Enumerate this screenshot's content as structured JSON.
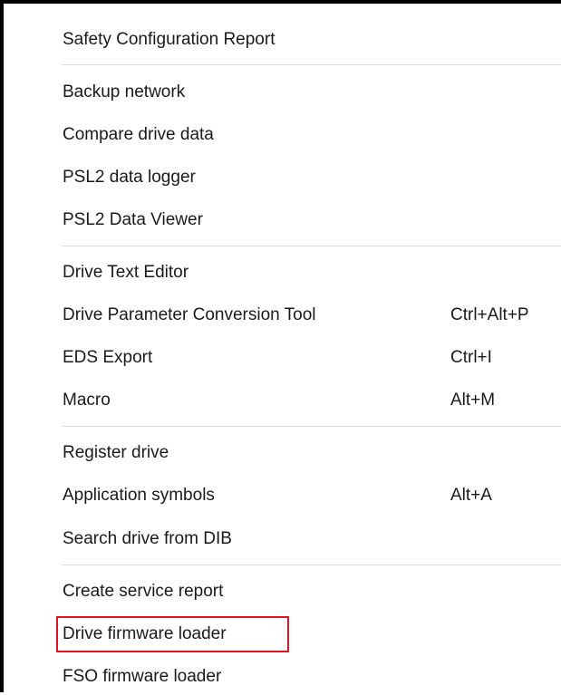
{
  "menu": {
    "items": [
      {
        "label": "Safety Configuration Report",
        "shortcut": ""
      },
      {
        "label": "Backup network",
        "shortcut": ""
      },
      {
        "label": "Compare drive data",
        "shortcut": ""
      },
      {
        "label": "PSL2 data logger",
        "shortcut": ""
      },
      {
        "label": "PSL2 Data Viewer",
        "shortcut": ""
      },
      {
        "label": "Drive Text Editor",
        "shortcut": ""
      },
      {
        "label": "Drive Parameter Conversion Tool",
        "shortcut": "Ctrl+Alt+P"
      },
      {
        "label": "EDS Export",
        "shortcut": "Ctrl+I"
      },
      {
        "label": "Macro",
        "shortcut": "Alt+M"
      },
      {
        "label": "Register drive",
        "shortcut": ""
      },
      {
        "label": "Application symbols",
        "shortcut": "Alt+A"
      },
      {
        "label": "Search drive from DIB",
        "shortcut": ""
      },
      {
        "label": "Create service report",
        "shortcut": ""
      },
      {
        "label": "Drive firmware loader",
        "shortcut": ""
      },
      {
        "label": "FSO firmware loader",
        "shortcut": ""
      }
    ],
    "highlighted_item": "Drive firmware loader",
    "highlight_color": "#e0141e",
    "separator_color": "#dcdcdc"
  }
}
